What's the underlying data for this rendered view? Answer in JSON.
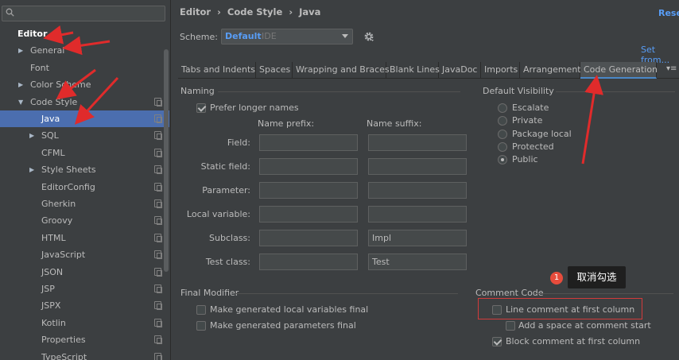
{
  "sidebar": {
    "search_placeholder": "",
    "items": [
      {
        "label": "Editor",
        "arrow": "",
        "copy": false
      },
      {
        "label": "General",
        "arrow": "▶",
        "copy": false
      },
      {
        "label": "Font",
        "arrow": "",
        "copy": false
      },
      {
        "label": "Color Scheme",
        "arrow": "▶",
        "copy": false
      },
      {
        "label": "Code Style",
        "arrow": "▼",
        "copy": true
      },
      {
        "label": "Java",
        "arrow": "",
        "copy": true
      },
      {
        "label": "SQL",
        "arrow": "▶",
        "copy": true
      },
      {
        "label": "CFML",
        "arrow": "",
        "copy": true
      },
      {
        "label": "Style Sheets",
        "arrow": "▶",
        "copy": true
      },
      {
        "label": "EditorConfig",
        "arrow": "",
        "copy": true
      },
      {
        "label": "Gherkin",
        "arrow": "",
        "copy": true
      },
      {
        "label": "Groovy",
        "arrow": "",
        "copy": true
      },
      {
        "label": "HTML",
        "arrow": "",
        "copy": true
      },
      {
        "label": "JavaScript",
        "arrow": "",
        "copy": true
      },
      {
        "label": "JSON",
        "arrow": "",
        "copy": true
      },
      {
        "label": "JSP",
        "arrow": "",
        "copy": true
      },
      {
        "label": "JSPX",
        "arrow": "",
        "copy": true
      },
      {
        "label": "Kotlin",
        "arrow": "",
        "copy": true
      },
      {
        "label": "Properties",
        "arrow": "",
        "copy": true
      },
      {
        "label": "TypeScript",
        "arrow": "",
        "copy": true
      }
    ]
  },
  "header": {
    "breadcrumb": [
      "Editor",
      "›",
      "Code Style",
      "›",
      "Java"
    ],
    "reset": "Rese",
    "scheme_label": "Scheme:",
    "scheme_value": "Default",
    "scheme_sub": "IDE",
    "set_from": "Set from..."
  },
  "tabs": [
    {
      "label": "Tabs and Indents",
      "active": false
    },
    {
      "label": "Spaces",
      "active": false
    },
    {
      "label": "Wrapping and Braces",
      "active": false
    },
    {
      "label": "Blank Lines",
      "active": false
    },
    {
      "label": "JavaDoc",
      "active": false
    },
    {
      "label": "Imports",
      "active": false
    },
    {
      "label": "Arrangement",
      "active": false
    },
    {
      "label": "Code Generation",
      "active": true
    }
  ],
  "tab_more": "▾≡",
  "naming": {
    "title": "Naming",
    "prefer_longer": {
      "label": "Prefer longer names",
      "checked": true
    },
    "col_prefix": "Name prefix:",
    "col_suffix": "Name suffix:",
    "rows": [
      {
        "label": "Field:",
        "prefix": "",
        "suffix": ""
      },
      {
        "label": "Static field:",
        "prefix": "",
        "suffix": ""
      },
      {
        "label": "Parameter:",
        "prefix": "",
        "suffix": ""
      },
      {
        "label": "Local variable:",
        "prefix": "",
        "suffix": ""
      },
      {
        "label": "Subclass:",
        "prefix": "",
        "suffix": "Impl"
      },
      {
        "label": "Test class:",
        "prefix": "",
        "suffix": "Test"
      }
    ]
  },
  "visibility": {
    "title": "Default Visibility",
    "options": [
      {
        "label": "Escalate",
        "checked": false
      },
      {
        "label": "Private",
        "checked": false
      },
      {
        "label": "Package local",
        "checked": false
      },
      {
        "label": "Protected",
        "checked": false
      },
      {
        "label": "Public",
        "checked": true
      }
    ]
  },
  "final_modifier": {
    "title": "Final Modifier",
    "options": [
      {
        "label": "Make generated local variables final",
        "checked": false
      },
      {
        "label": "Make generated parameters final",
        "checked": false
      }
    ]
  },
  "comment_code": {
    "title": "Comment Code",
    "options": [
      {
        "label": "Line comment at first column",
        "checked": false
      },
      {
        "label": "Add a space at comment start",
        "checked": false
      },
      {
        "label": "Block comment at first column",
        "checked": true
      }
    ]
  },
  "annotation": {
    "badge": "1",
    "tooltip": "取消勾选",
    "color": "#d23b3b"
  }
}
